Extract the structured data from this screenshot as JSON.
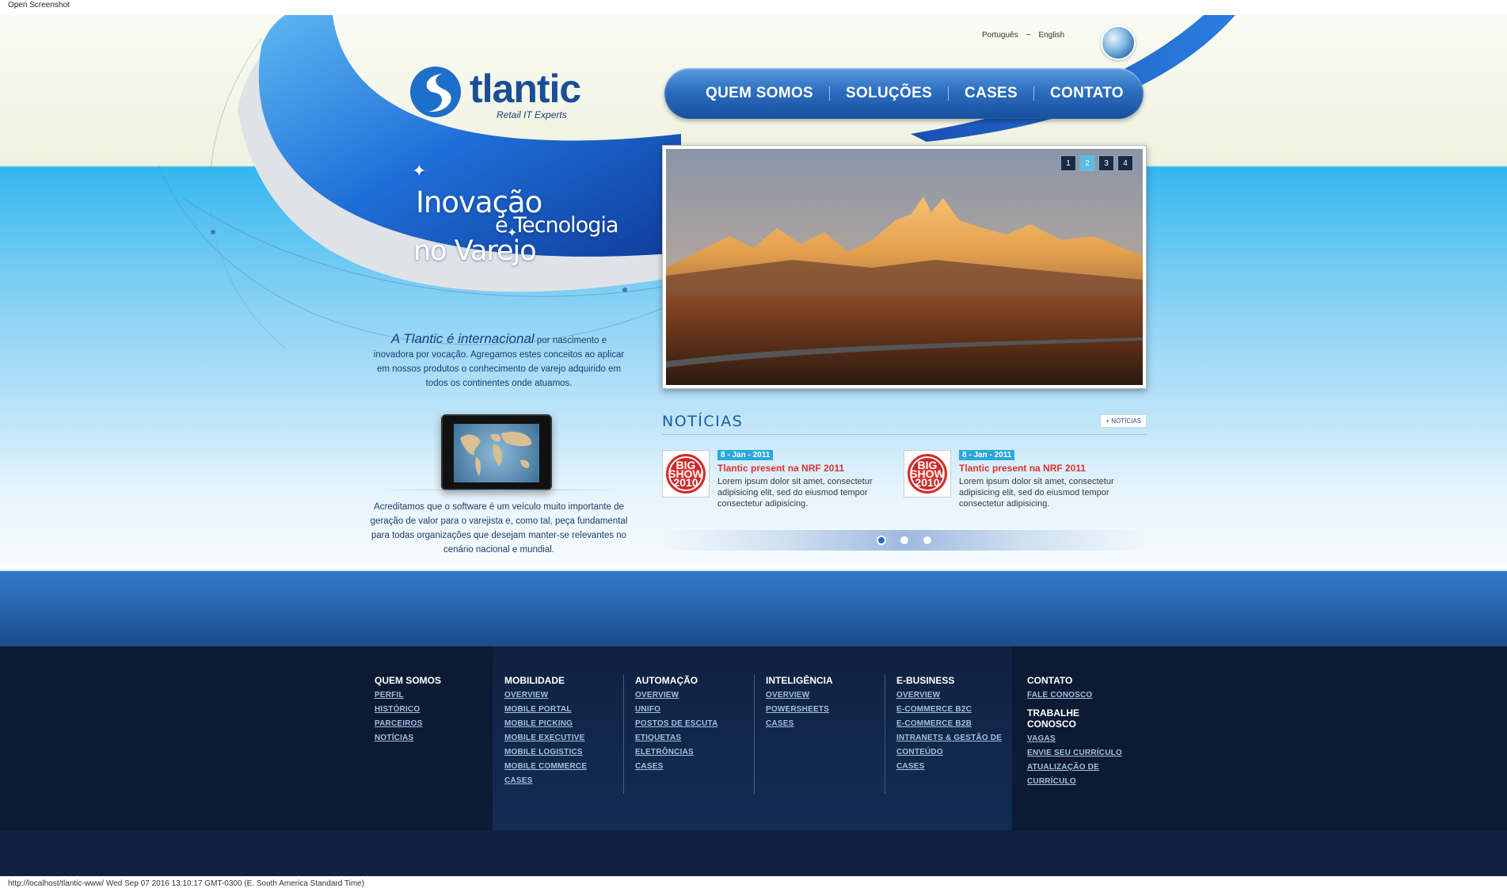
{
  "window": {
    "title": "Open Screenshot"
  },
  "languages": [
    "Português",
    "~",
    "English"
  ],
  "logo": {
    "brand": "tlantic",
    "tagline": "Retail IT Experts"
  },
  "nav": {
    "items": [
      "QUEM SOMOS",
      "SOLUÇÕES",
      "CASES",
      "CONTATO"
    ]
  },
  "slogan": {
    "line1": "Inovação",
    "line2": "e Tecnologia",
    "line3": "no Varejo"
  },
  "intro": {
    "lead": "A Tlantic é internacional",
    "text": " por nascimento e inovadora por vocação. Agregamos estes conceitos ao aplicar em nossos produtos o conhecimento de varejo adquirido em todos os continentes onde atuamos."
  },
  "belief": "Acreditamos que o software é um veículo muito importante de geração de valor para o varejista e, como tal, peça fundamental para todas organizações que desejam manter-se relevantes no cenário nacional e mundial.",
  "slider": {
    "pages": [
      "1",
      "2",
      "3",
      "4"
    ],
    "active": 2
  },
  "news": {
    "heading": "NOTÍCIAS",
    "more": "+ NOTÍCIAS",
    "badge_text": "BIG SHOW 2010",
    "items": [
      {
        "date": "8 - Jan - 2011",
        "title": "Tlantic present na NRF 2011",
        "body": "Lorem ipsum dolor sit amet, consectetur adipisicing elit, sed do eiusmod tempor consectetur adipisicing."
      },
      {
        "date": "8 - Jan - 2011",
        "title": "Tlantic present na NRF 2011",
        "body": "Lorem ipsum dolor sit amet, consectetur adipisicing elit, sed do eiusmod tempor consectetur adipisicing."
      }
    ],
    "pagination_count": 3,
    "pagination_active": 1
  },
  "footer": {
    "quem": {
      "title": "QUEM SOMOS",
      "links": [
        "PERFIL",
        "HISTÓRICO",
        "PARCEIROS",
        "NOTÍCIAS"
      ]
    },
    "mobilidade": {
      "title": "MOBILIDADE",
      "links": [
        "OVERVIEW",
        "MOBILE PORTAL",
        "MOBILE PICKING",
        "MOBILE EXECUTIVE",
        "MOBILE LOGISTICS",
        "MOBILE COMMERCE",
        "CASES"
      ]
    },
    "automacao": {
      "title": "AUTOMAÇÃO",
      "links": [
        "OVERVIEW",
        "UNIFO",
        "POSTOS DE ESCUTA",
        "ETIQUETAS",
        "ELETRÔNCIAS",
        "CASES"
      ]
    },
    "inteligencia": {
      "title": "INTELIGÊNCIA",
      "links": [
        "OVERVIEW",
        "POWERSHEETS",
        "CASES"
      ]
    },
    "ebusiness": {
      "title": "E-BUSINESS",
      "links": [
        "OVERVIEW",
        "E-COMMERCE B2C",
        "E-COMMERCE B2B",
        "INTRANETS & GESTÃO DE",
        "CONTEÚDO",
        "CASES"
      ]
    },
    "contato": {
      "title": "CONTATO",
      "links": [
        "FALE CONOSCO"
      ],
      "title2": "TRABALHE CONOSCO",
      "links2": [
        "VAGAS",
        "ENVIE SEU CURRÍCULO",
        "ATUALIZAÇÃO DE",
        "CURRÍCULO"
      ]
    }
  },
  "status": "http://localhost/tlantic-www/ Wed Sep 07 2016 13:10:17 GMT-0300 (E. South America Standard Time)"
}
